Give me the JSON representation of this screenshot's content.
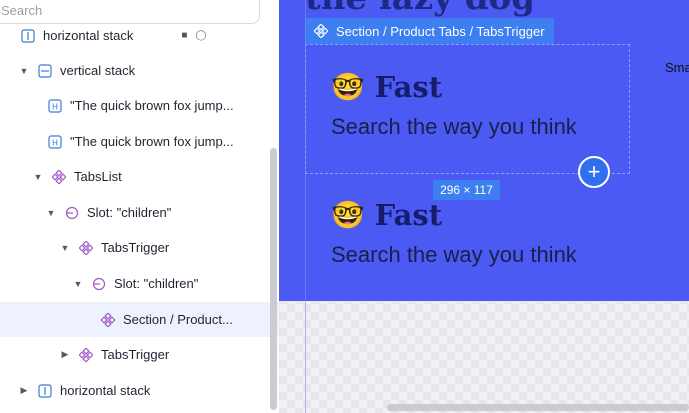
{
  "search": {
    "placeholder": "Search"
  },
  "tree": {
    "rows": [
      {
        "label": "horizontal stack",
        "icon": "horizontal-stack-icon",
        "caret": "none"
      },
      {
        "label": "vertical stack",
        "icon": "vertical-stack-icon",
        "caret": "expanded"
      },
      {
        "label": "\"The quick brown fox jump...",
        "icon": "heading-icon",
        "caret": "none"
      },
      {
        "label": "\"The quick brown fox jump...",
        "icon": "heading-icon",
        "caret": "none"
      },
      {
        "label": "TabsList",
        "icon": "component-icon",
        "caret": "expanded"
      },
      {
        "label": "Slot: \"children\"",
        "icon": "slot-icon",
        "caret": "expanded"
      },
      {
        "label": "TabsTrigger",
        "icon": "component-icon",
        "caret": "expanded"
      },
      {
        "label": "Slot: \"children\"",
        "icon": "slot-icon",
        "caret": "expanded"
      },
      {
        "label": "Section / Product...",
        "icon": "component-icon",
        "caret": "none",
        "selected": true
      },
      {
        "label": "TabsTrigger",
        "icon": "component-icon",
        "caret": "collapsed"
      },
      {
        "label": "horizontal stack",
        "icon": "horizontal-stack-icon",
        "caret": "collapsed"
      }
    ]
  },
  "canvas": {
    "partial_heading": "the lazy dog",
    "breadcrumb": "Section / Product Tabs / TabsTrigger",
    "size_badge": "296 × 117",
    "side_text": "Sma",
    "cards": [
      {
        "emoji": "🤓",
        "title": "Fast",
        "subtitle": "Search the way you think"
      },
      {
        "emoji": "🤓",
        "title": "Fast",
        "subtitle": "Search the way you think"
      }
    ],
    "add_label": "+"
  },
  "colors": {
    "canvas_blue": "#4a5af2",
    "accent": "#3d7ef0",
    "component_icon": "#a259c9",
    "selected_row": "#eef2fd"
  }
}
